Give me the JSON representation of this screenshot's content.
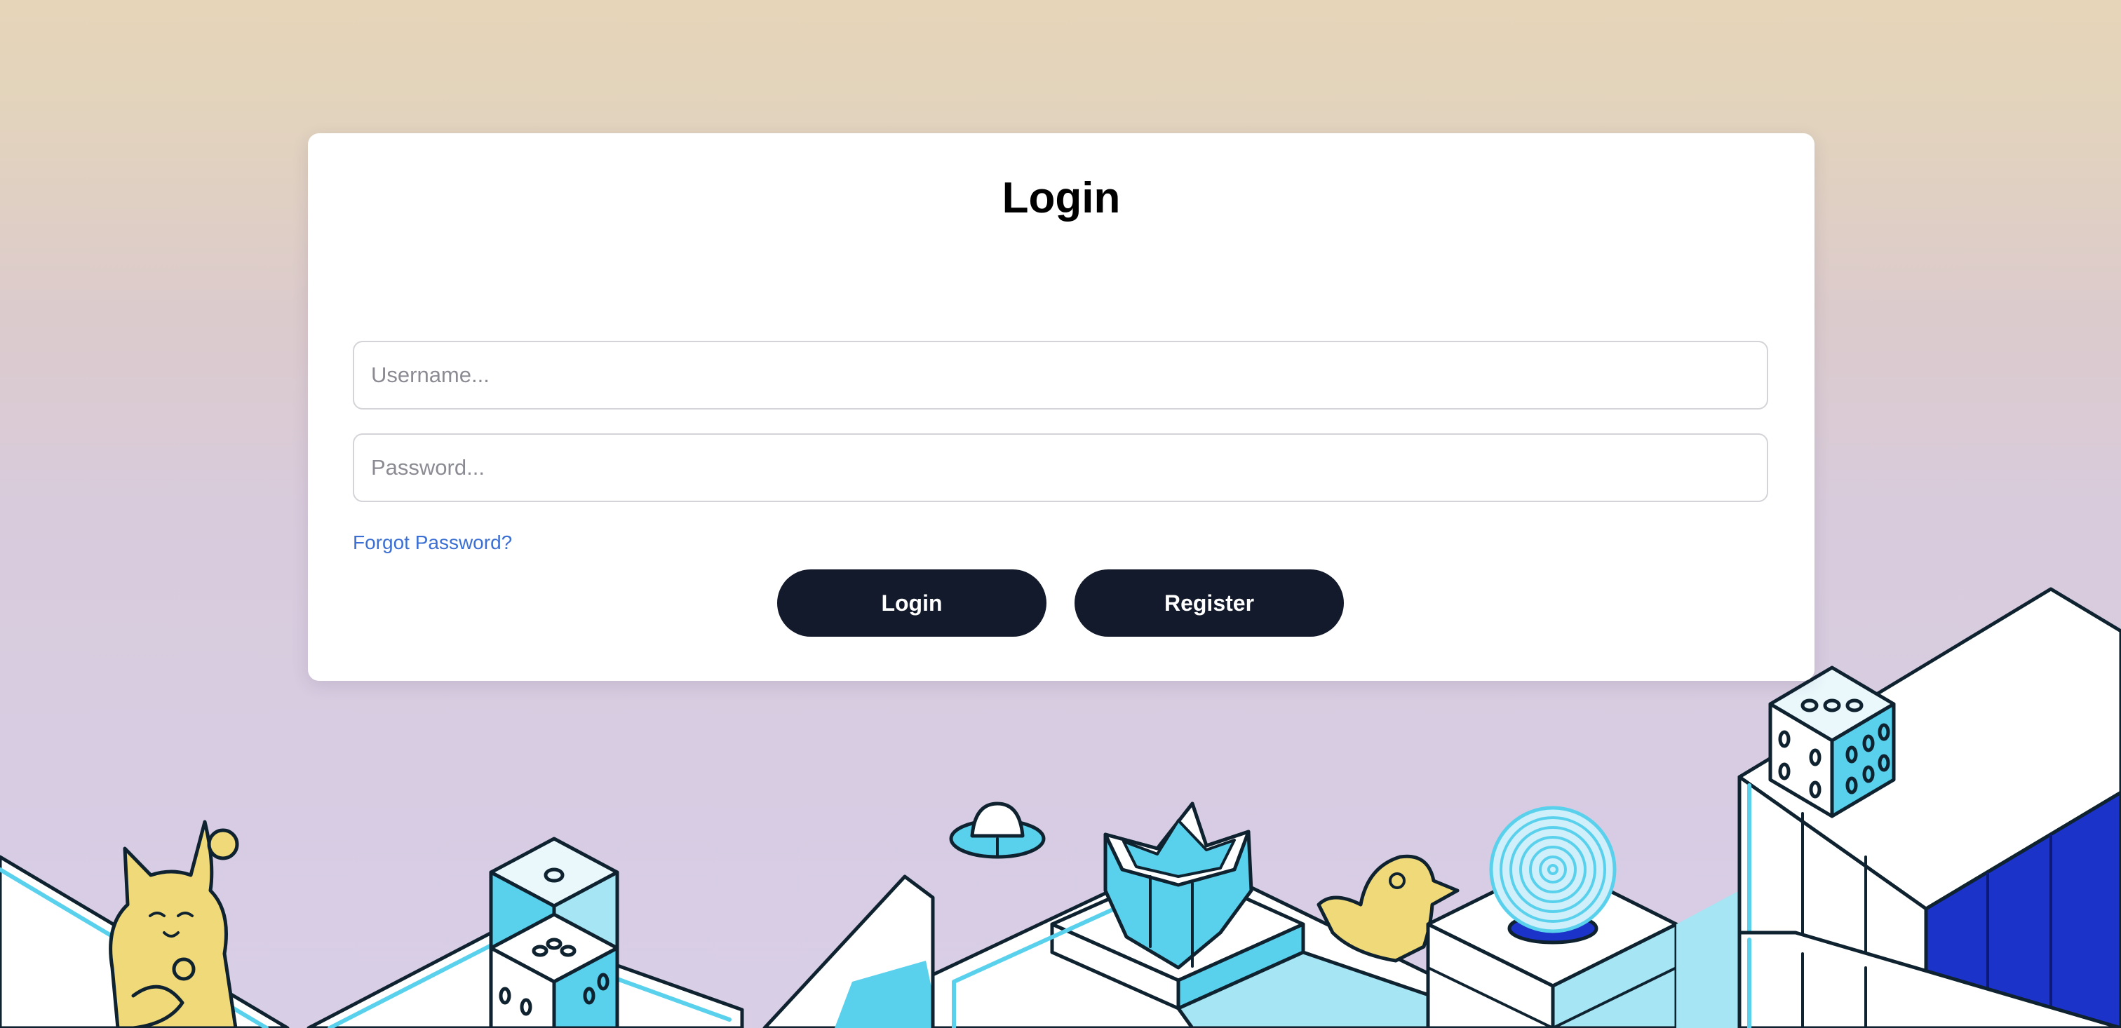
{
  "login_card": {
    "title": "Login",
    "username_placeholder": "Username...",
    "password_placeholder": "Password...",
    "forgot_password_label": "Forgot Password?",
    "login_button_label": "Login",
    "register_button_label": "Register"
  },
  "colors": {
    "background_top": "#e6d5b8",
    "background_bottom": "#d8cee6",
    "button": "#131a2b",
    "link": "#3b6fd4",
    "illustration_cyan": "#5ad1ec",
    "illustration_blue": "#1c33c9",
    "illustration_yellow": "#efd978"
  },
  "illustration": {
    "icons": [
      "lucky-cat-icon",
      "dice-icon",
      "ufo-icon",
      "star-of-david-icon",
      "rubber-duck-icon",
      "spiral-orb-icon"
    ]
  }
}
